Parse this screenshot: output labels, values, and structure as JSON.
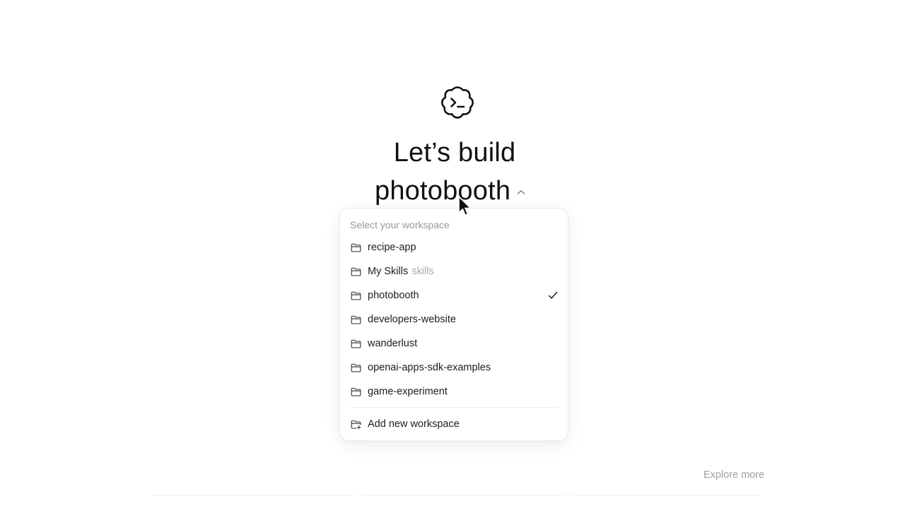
{
  "hero": {
    "headline": "Let’s build",
    "workspace_name": "photobooth"
  },
  "dropdown": {
    "heading": "Select your workspace",
    "items": [
      {
        "label": "recipe-app",
        "secondary": "",
        "selected": false
      },
      {
        "label": "My Skills",
        "secondary": "skills",
        "selected": false
      },
      {
        "label": "photobooth",
        "secondary": "",
        "selected": true
      },
      {
        "label": "developers-website",
        "secondary": "",
        "selected": false
      },
      {
        "label": "wanderlust",
        "secondary": "",
        "selected": false
      },
      {
        "label": "openai-apps-sdk-examples",
        "secondary": "",
        "selected": false
      },
      {
        "label": "game-experiment",
        "secondary": "",
        "selected": false
      }
    ],
    "add_label": "Add new workspace"
  },
  "footer": {
    "explore_label": "Explore more"
  },
  "icons": {
    "logo": "codex-logo-icon",
    "folder": "folder-icon",
    "add_folder": "folder-add-icon",
    "check": "check-icon",
    "chevron": "chevron-up-icon",
    "cursor": "mouse-pointer-icon"
  }
}
